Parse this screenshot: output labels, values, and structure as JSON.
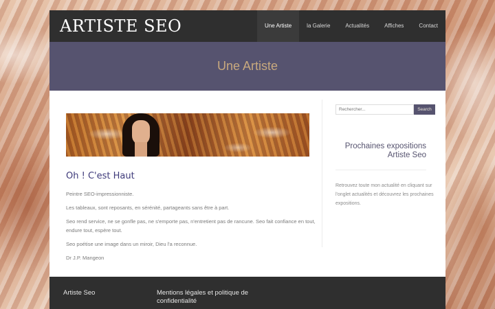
{
  "site": {
    "logo": "ARTISTE SEO"
  },
  "nav": {
    "items": [
      {
        "label": "Une Artiste"
      },
      {
        "label": "la Galerie"
      },
      {
        "label": "Actualités"
      },
      {
        "label": "Affiches"
      },
      {
        "label": "Contact"
      }
    ]
  },
  "banner": {
    "title": "Une Artiste"
  },
  "post": {
    "title": "Oh ! C'est Haut",
    "paragraphs": [
      "Peintre SEO-impressionniste.",
      "Les tableaux, sont reposants, en sérénité, partageants sans être à part.",
      "Seo rend service, ne se gonfle pas, ne s'emporte pas, n'entretient pas de rancune. Seo fait confiance en tout, endure tout, espère tout.",
      "Seo poétise une image dans un miroir, Dieu l'a reconnue.",
      "Dr J.P. Mangeon"
    ]
  },
  "sidebar": {
    "search_placeholder": "Rechercher...",
    "search_button": "Search",
    "widget_title": "Prochaines expositions Artiste Seo",
    "widget_text": "Retrouvez toute mon actualité en cliquant sur l'onglet actualités et découvrez les prochaines expositions."
  },
  "footer": {
    "col1_title": "Artiste Seo",
    "col2_title": "Mentions légales et politique de confidentialité"
  },
  "colors": {
    "header_bg": "#2f2f2f",
    "banner_bg": "#56536f",
    "banner_text": "#c8a97e",
    "post_title": "#3e3a7a"
  }
}
